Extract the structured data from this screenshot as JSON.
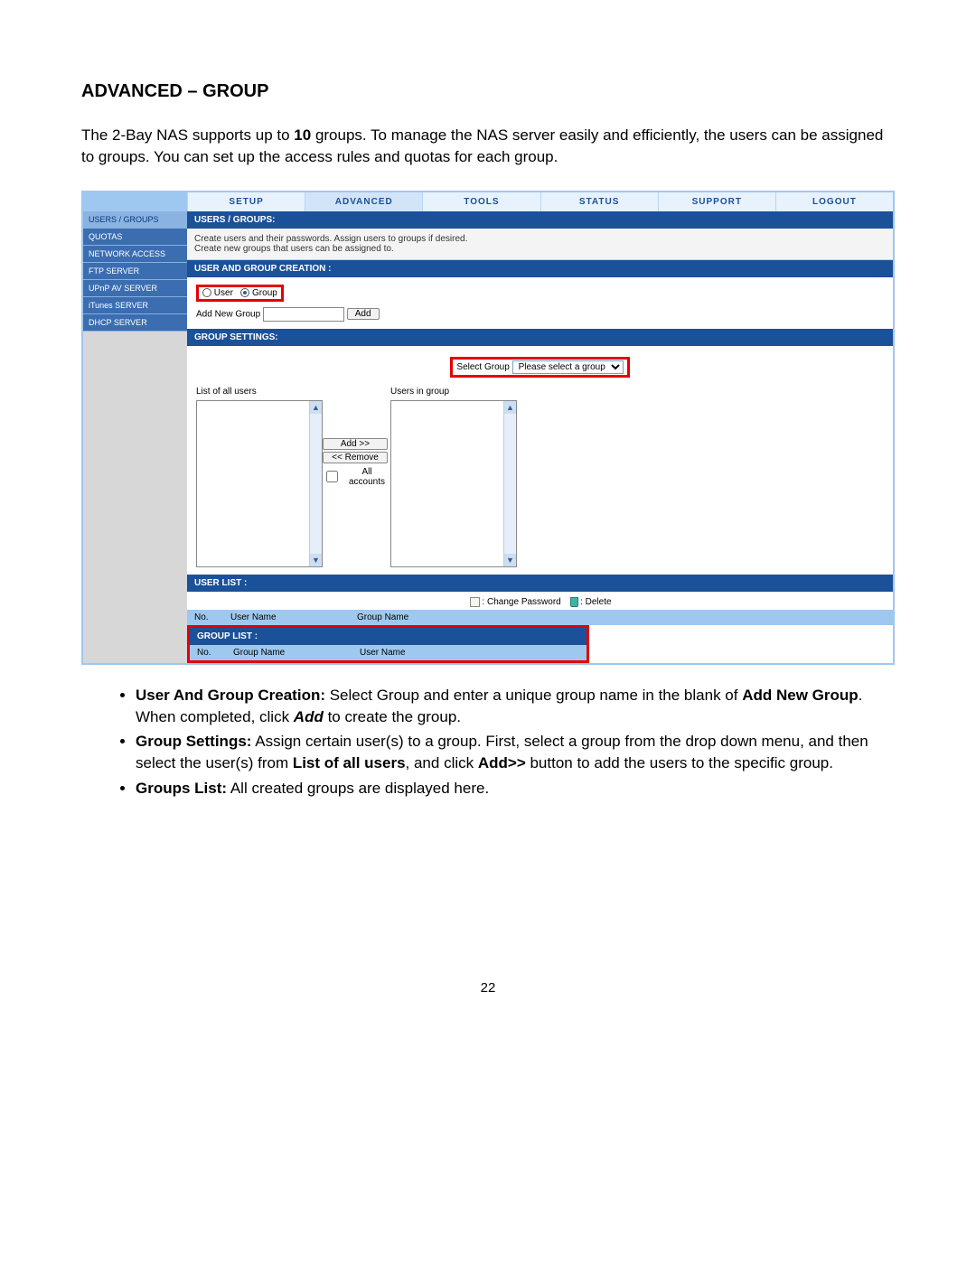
{
  "doc": {
    "heading": "ADVANCED – GROUP",
    "intro_before_bold": "The 2-Bay NAS supports up to ",
    "intro_bold": "10",
    "intro_after_bold": " groups. To manage the NAS server easily and efficiently, the users can be assigned to groups. You can set up the access rules and quotas for each group.",
    "page_number": "22"
  },
  "topnav": [
    "SETUP",
    "ADVANCED",
    "TOOLS",
    "STATUS",
    "SUPPORT",
    "LOGOUT"
  ],
  "topnav_active_index": 1,
  "sidebar": [
    "USERS / GROUPS",
    "QUOTAS",
    "NETWORK ACCESS",
    "FTP SERVER",
    "UPnP AV SERVER",
    "iTunes SERVER",
    "DHCP SERVER"
  ],
  "sidebar_selected_index": 0,
  "panels": {
    "users_groups": {
      "title": "USERS / GROUPS:",
      "desc1": "Create users and their passwords. Assign users to groups if desired.",
      "desc2": "Create new groups that users can be assigned to."
    },
    "creation": {
      "title": "USER AND GROUP CREATION :",
      "user_label": "User",
      "group_label": "Group",
      "addnew_label": "Add New Group",
      "add_button": "Add"
    },
    "group_settings": {
      "title": "GROUP SETTINGS:",
      "select_group_label": "Select Group",
      "select_group_value": "Please select a group",
      "list_all_users": "List of all users",
      "users_in_group": "Users in group",
      "add_btn": "Add >>",
      "remove_btn": "<< Remove",
      "all_accounts": "All accounts"
    },
    "user_list": {
      "title": "USER LIST :",
      "change_pw": ": Change Password",
      "delete": ": Delete",
      "col_no": "No.",
      "col_user": "User Name",
      "col_group": "Group Name"
    },
    "group_list": {
      "title": "GROUP LIST :",
      "col_no": "No.",
      "col_group": "Group Name",
      "col_user": "User Name"
    }
  },
  "bullets": {
    "b1": {
      "t1": "User And Group Creation:",
      "t2": " Select Group and enter a unique group name in the blank of ",
      "t3": "Add New Group",
      "t4": ". When completed, click ",
      "t5": "Add",
      "t6": "  to create the group."
    },
    "b2": {
      "t1": "Group Settings:",
      "t2": "  Assign certain user(s) to a group. First, select a group from the drop down menu, and then select the user(s) from ",
      "t3": "List of all users",
      "t4": ", and click ",
      "t5": "Add>>",
      "t6": " button to add the users to the specific group."
    },
    "b3": {
      "t1": "Groups List:",
      "t2": " All created groups are displayed here."
    }
  }
}
